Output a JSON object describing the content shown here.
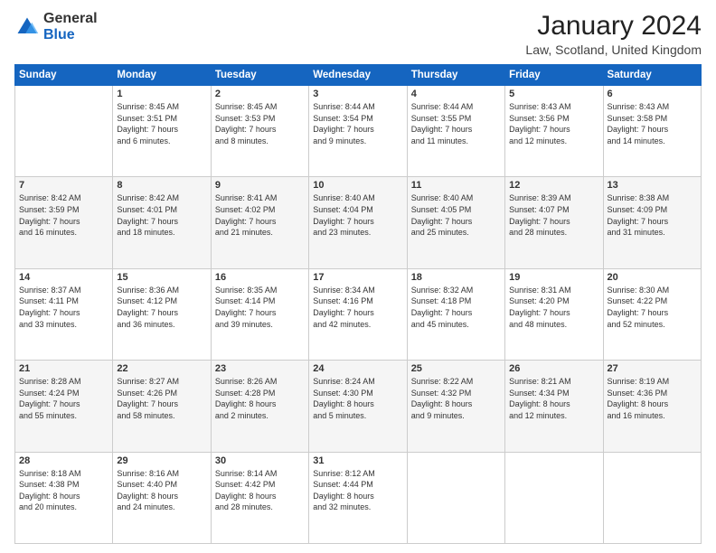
{
  "header": {
    "logo_general": "General",
    "logo_blue": "Blue",
    "month_title": "January 2024",
    "location": "Law, Scotland, United Kingdom"
  },
  "days_of_week": [
    "Sunday",
    "Monday",
    "Tuesday",
    "Wednesday",
    "Thursday",
    "Friday",
    "Saturday"
  ],
  "weeks": [
    [
      {
        "day": "",
        "info": ""
      },
      {
        "day": "1",
        "info": "Sunrise: 8:45 AM\nSunset: 3:51 PM\nDaylight: 7 hours\nand 6 minutes."
      },
      {
        "day": "2",
        "info": "Sunrise: 8:45 AM\nSunset: 3:53 PM\nDaylight: 7 hours\nand 8 minutes."
      },
      {
        "day": "3",
        "info": "Sunrise: 8:44 AM\nSunset: 3:54 PM\nDaylight: 7 hours\nand 9 minutes."
      },
      {
        "day": "4",
        "info": "Sunrise: 8:44 AM\nSunset: 3:55 PM\nDaylight: 7 hours\nand 11 minutes."
      },
      {
        "day": "5",
        "info": "Sunrise: 8:43 AM\nSunset: 3:56 PM\nDaylight: 7 hours\nand 12 minutes."
      },
      {
        "day": "6",
        "info": "Sunrise: 8:43 AM\nSunset: 3:58 PM\nDaylight: 7 hours\nand 14 minutes."
      }
    ],
    [
      {
        "day": "7",
        "info": "Sunrise: 8:42 AM\nSunset: 3:59 PM\nDaylight: 7 hours\nand 16 minutes."
      },
      {
        "day": "8",
        "info": "Sunrise: 8:42 AM\nSunset: 4:01 PM\nDaylight: 7 hours\nand 18 minutes."
      },
      {
        "day": "9",
        "info": "Sunrise: 8:41 AM\nSunset: 4:02 PM\nDaylight: 7 hours\nand 21 minutes."
      },
      {
        "day": "10",
        "info": "Sunrise: 8:40 AM\nSunset: 4:04 PM\nDaylight: 7 hours\nand 23 minutes."
      },
      {
        "day": "11",
        "info": "Sunrise: 8:40 AM\nSunset: 4:05 PM\nDaylight: 7 hours\nand 25 minutes."
      },
      {
        "day": "12",
        "info": "Sunrise: 8:39 AM\nSunset: 4:07 PM\nDaylight: 7 hours\nand 28 minutes."
      },
      {
        "day": "13",
        "info": "Sunrise: 8:38 AM\nSunset: 4:09 PM\nDaylight: 7 hours\nand 31 minutes."
      }
    ],
    [
      {
        "day": "14",
        "info": "Sunrise: 8:37 AM\nSunset: 4:11 PM\nDaylight: 7 hours\nand 33 minutes."
      },
      {
        "day": "15",
        "info": "Sunrise: 8:36 AM\nSunset: 4:12 PM\nDaylight: 7 hours\nand 36 minutes."
      },
      {
        "day": "16",
        "info": "Sunrise: 8:35 AM\nSunset: 4:14 PM\nDaylight: 7 hours\nand 39 minutes."
      },
      {
        "day": "17",
        "info": "Sunrise: 8:34 AM\nSunset: 4:16 PM\nDaylight: 7 hours\nand 42 minutes."
      },
      {
        "day": "18",
        "info": "Sunrise: 8:32 AM\nSunset: 4:18 PM\nDaylight: 7 hours\nand 45 minutes."
      },
      {
        "day": "19",
        "info": "Sunrise: 8:31 AM\nSunset: 4:20 PM\nDaylight: 7 hours\nand 48 minutes."
      },
      {
        "day": "20",
        "info": "Sunrise: 8:30 AM\nSunset: 4:22 PM\nDaylight: 7 hours\nand 52 minutes."
      }
    ],
    [
      {
        "day": "21",
        "info": "Sunrise: 8:28 AM\nSunset: 4:24 PM\nDaylight: 7 hours\nand 55 minutes."
      },
      {
        "day": "22",
        "info": "Sunrise: 8:27 AM\nSunset: 4:26 PM\nDaylight: 7 hours\nand 58 minutes."
      },
      {
        "day": "23",
        "info": "Sunrise: 8:26 AM\nSunset: 4:28 PM\nDaylight: 8 hours\nand 2 minutes."
      },
      {
        "day": "24",
        "info": "Sunrise: 8:24 AM\nSunset: 4:30 PM\nDaylight: 8 hours\nand 5 minutes."
      },
      {
        "day": "25",
        "info": "Sunrise: 8:22 AM\nSunset: 4:32 PM\nDaylight: 8 hours\nand 9 minutes."
      },
      {
        "day": "26",
        "info": "Sunrise: 8:21 AM\nSunset: 4:34 PM\nDaylight: 8 hours\nand 12 minutes."
      },
      {
        "day": "27",
        "info": "Sunrise: 8:19 AM\nSunset: 4:36 PM\nDaylight: 8 hours\nand 16 minutes."
      }
    ],
    [
      {
        "day": "28",
        "info": "Sunrise: 8:18 AM\nSunset: 4:38 PM\nDaylight: 8 hours\nand 20 minutes."
      },
      {
        "day": "29",
        "info": "Sunrise: 8:16 AM\nSunset: 4:40 PM\nDaylight: 8 hours\nand 24 minutes."
      },
      {
        "day": "30",
        "info": "Sunrise: 8:14 AM\nSunset: 4:42 PM\nDaylight: 8 hours\nand 28 minutes."
      },
      {
        "day": "31",
        "info": "Sunrise: 8:12 AM\nSunset: 4:44 PM\nDaylight: 8 hours\nand 32 minutes."
      },
      {
        "day": "",
        "info": ""
      },
      {
        "day": "",
        "info": ""
      },
      {
        "day": "",
        "info": ""
      }
    ]
  ]
}
